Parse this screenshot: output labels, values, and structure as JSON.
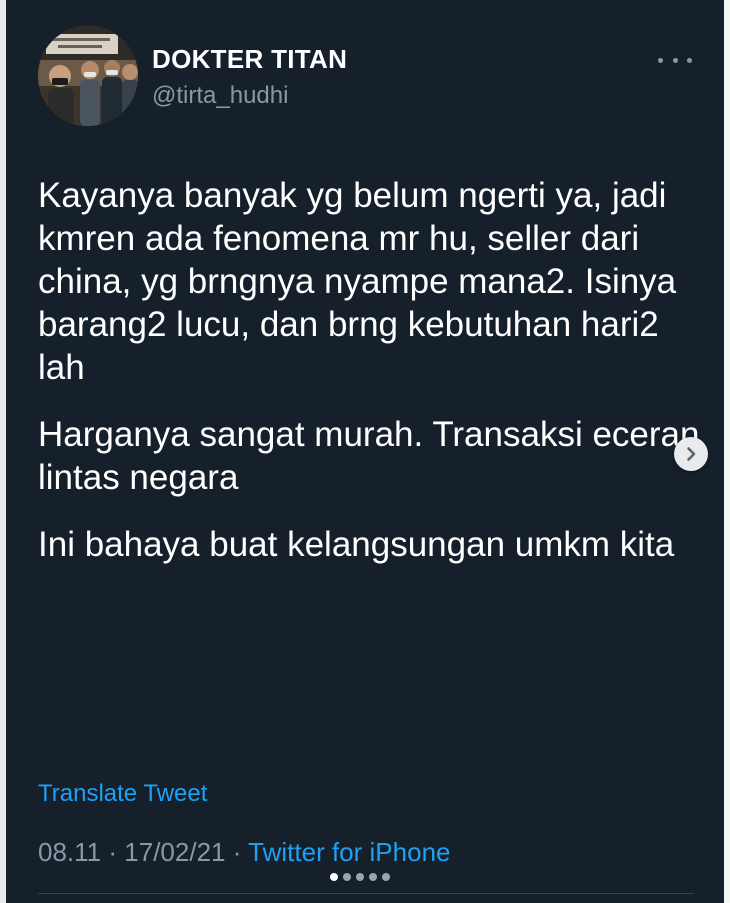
{
  "tweet": {
    "author_name": "DOKTER TITAN",
    "author_handle": "@tirta_hudhi",
    "paragraphs": [
      "Kayanya banyak yg belum ngerti ya, jadi kmren ada fenomena mr hu, seller dari china, yg brngnya nyampe mana2. Isinya barang2 lucu, dan brng kebutuhan hari2 lah",
      "Harganya sangat murah. Transaksi eceran lintas negara",
      "Ini bahaya buat kelangsungan umkm kita"
    ],
    "translate_label": "Translate Tweet",
    "time": "08.11",
    "date": "17/02/21",
    "separator": "·",
    "source": "Twitter for iPhone"
  },
  "icons": {
    "more": "more-horizontal-icon",
    "next": "chevron-right-icon"
  },
  "carousel": {
    "total_slides": 5,
    "active_slide": 1
  },
  "colors": {
    "background": "#15202b",
    "text": "#ffffff",
    "secondary_text": "#8899a6",
    "accent": "#1da1f2"
  }
}
